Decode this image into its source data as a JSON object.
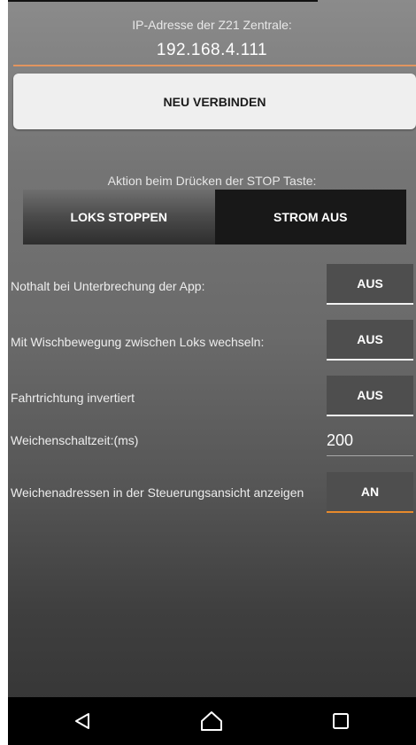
{
  "connection": {
    "ip_label": "IP-Adresse der Z21 Zentrale:",
    "ip_value": "192.168.4.111",
    "reconnect_label": "NEU VERBINDEN"
  },
  "stop_action": {
    "label": "Aktion beim Drücken der STOP Taste:",
    "options": [
      "LOKS STOPPEN",
      "STROM AUS"
    ],
    "selected": "STROM AUS"
  },
  "settings": [
    {
      "label": "Nothalt bei Unterbrechung der App:",
      "value": "AUS"
    },
    {
      "label": "Mit Wischbewegung zwischen Loks wechseln:",
      "value": "AUS"
    },
    {
      "label": "Fahrtrichtung invertiert",
      "value": "AUS"
    },
    {
      "label": "Weichenschaltzeit:(ms)",
      "value": "200"
    },
    {
      "label": "Weichenadressen in der Steuerungsansicht anzeigen",
      "value": "AN"
    }
  ],
  "colors": {
    "accent": "#e88a2b",
    "ip_underline": "#e2955f",
    "navbar": "#000000"
  },
  "navbar": {
    "icons": [
      "back-icon",
      "home-icon",
      "recents-icon"
    ]
  }
}
